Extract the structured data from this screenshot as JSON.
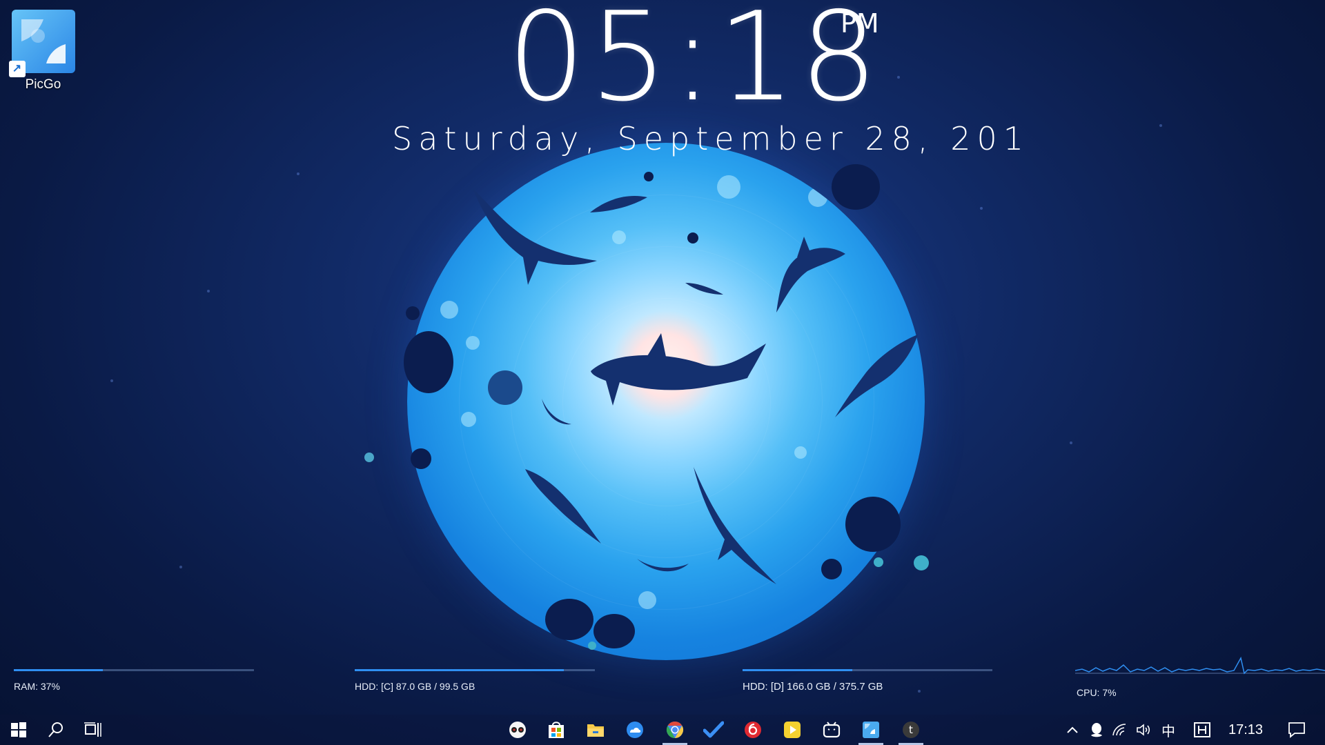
{
  "clock": {
    "time": "05:18",
    "ampm": "PM"
  },
  "date": "Saturday, September 28, 201",
  "desktop": {
    "icon_label": "PicGo"
  },
  "meters": {
    "ram": {
      "label": "RAM: 37%",
      "fraction": 0.37
    },
    "hdd_c": {
      "label": "HDD: [C] 87.0 GB / 99.5 GB",
      "fraction": 0.87
    },
    "hdd_d": {
      "label": "HDD: [D] 166.0 GB / 375.7 GB",
      "fraction": 0.44
    },
    "cpu": {
      "label": "CPU: 7%"
    }
  },
  "taskbar": {
    "left": [
      "windows-start-icon",
      "search-icon",
      "task-view-icon"
    ],
    "apps": [
      "cheese-app-icon",
      "store-icon",
      "file-explorer-icon",
      "cloud-app-icon",
      "chrome-icon",
      "todo-icon",
      "netease-music-icon",
      "video-player-icon",
      "bilibili-icon",
      "picgo-icon",
      "typora-icon"
    ],
    "tray": [
      "chevron-up-icon",
      "qq-icon",
      "wifi-icon",
      "volume-icon"
    ],
    "ime": "中",
    "time": "17:13"
  },
  "colors": {
    "accent": "#2f8ff2",
    "ocean_center": "#fff2ee",
    "ocean_edge": "#0f69cf",
    "background": "#0a1a45"
  }
}
